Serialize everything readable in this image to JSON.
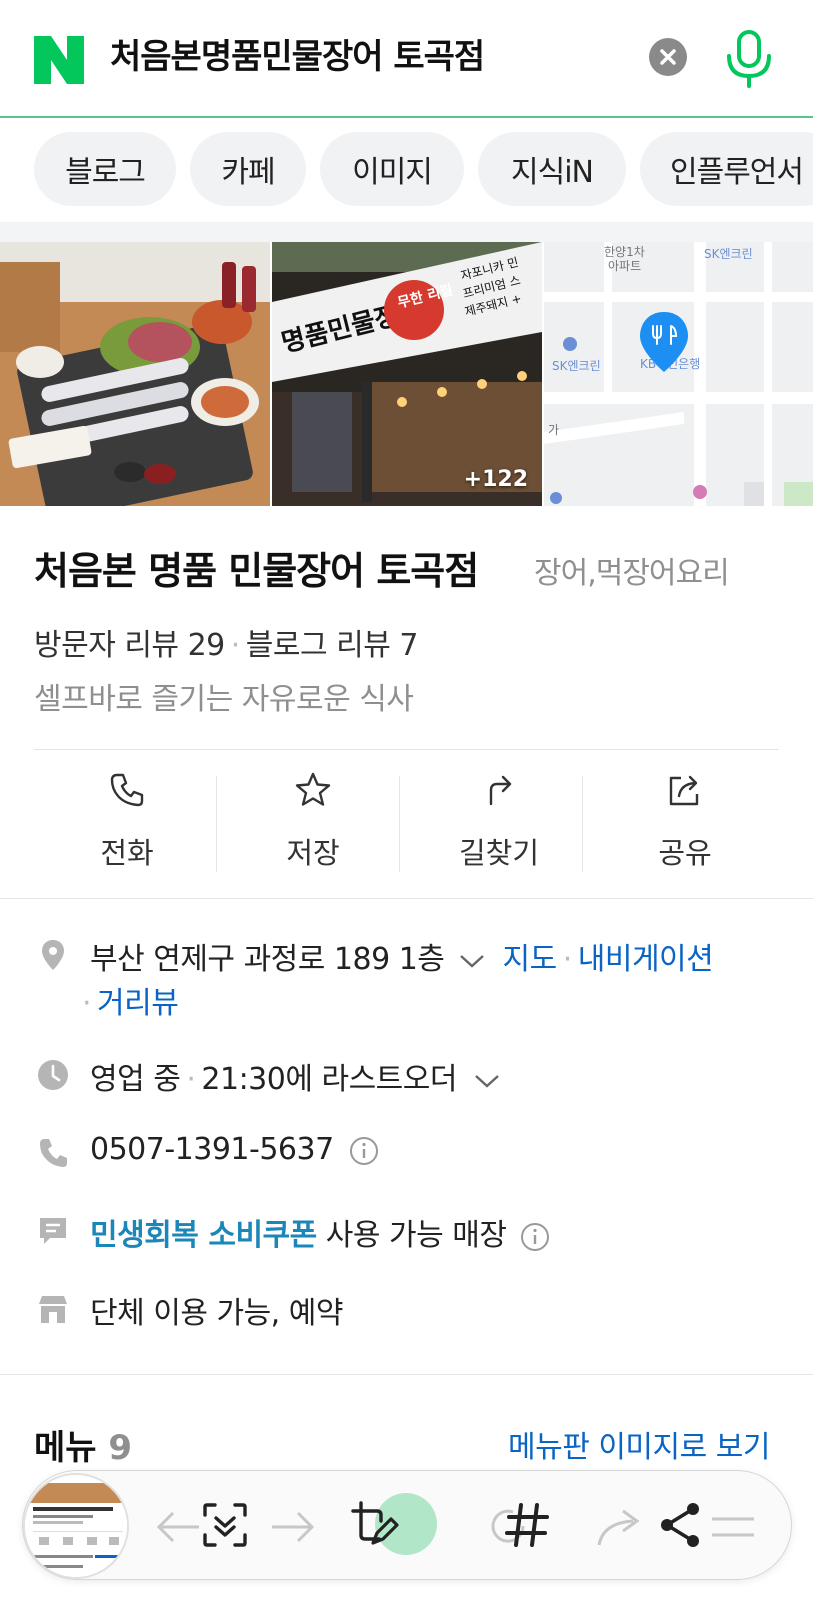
{
  "search": {
    "query": "처음본명품민물장어 토곡점"
  },
  "tabs": [
    "블로그",
    "카페",
    "이미지",
    "지식iN",
    "인플루언서"
  ],
  "photos": {
    "more_count": "+122"
  },
  "map_labels": [
    "한양1차",
    "아파트",
    "SK엔크린",
    "SK엔크린",
    "KB국민은행",
    "가"
  ],
  "store_signage": {
    "name": "명품민물장어",
    "badge": "무한 리필",
    "sign_lines": [
      "자포니카 민",
      "프리미엄 스",
      "제주돼지 +"
    ]
  },
  "place": {
    "name": "처음본 명품 민물장어 토곡점",
    "category": "장어,먹장어요리",
    "visitor_reviews": "방문자 리뷰 29",
    "blog_reviews": "블로그 리뷰 7",
    "tagline": "셀프바로 즐기는 자유로운 식사"
  },
  "actions": [
    {
      "label": "전화",
      "icon": "phone-icon"
    },
    {
      "label": "저장",
      "icon": "star-icon"
    },
    {
      "label": "길찾기",
      "icon": "directions-icon"
    },
    {
      "label": "공유",
      "icon": "share-icon"
    }
  ],
  "info": {
    "address": "부산 연제구 과정로 189 1층",
    "map_link": "지도",
    "navigation_link": "내비게이션",
    "streetview_link": "거리뷰",
    "status": "영업 중",
    "last_order": "21:30에 라스트오더",
    "phone": "0507-1391-5637",
    "coupon_link": "민생회복 소비쿠폰",
    "coupon_text": "사용 가능 매장",
    "facilities": "단체 이용 가능, 예약"
  },
  "menu": {
    "title": "메뉴",
    "count": "9",
    "view_image_link": "메뉴판 이미지로 보기"
  },
  "colors": {
    "naver_green": "#03c75a",
    "link_blue": "#0a64c4",
    "coupon_teal": "#1b86b8",
    "divider_green": "#5bc38c"
  }
}
